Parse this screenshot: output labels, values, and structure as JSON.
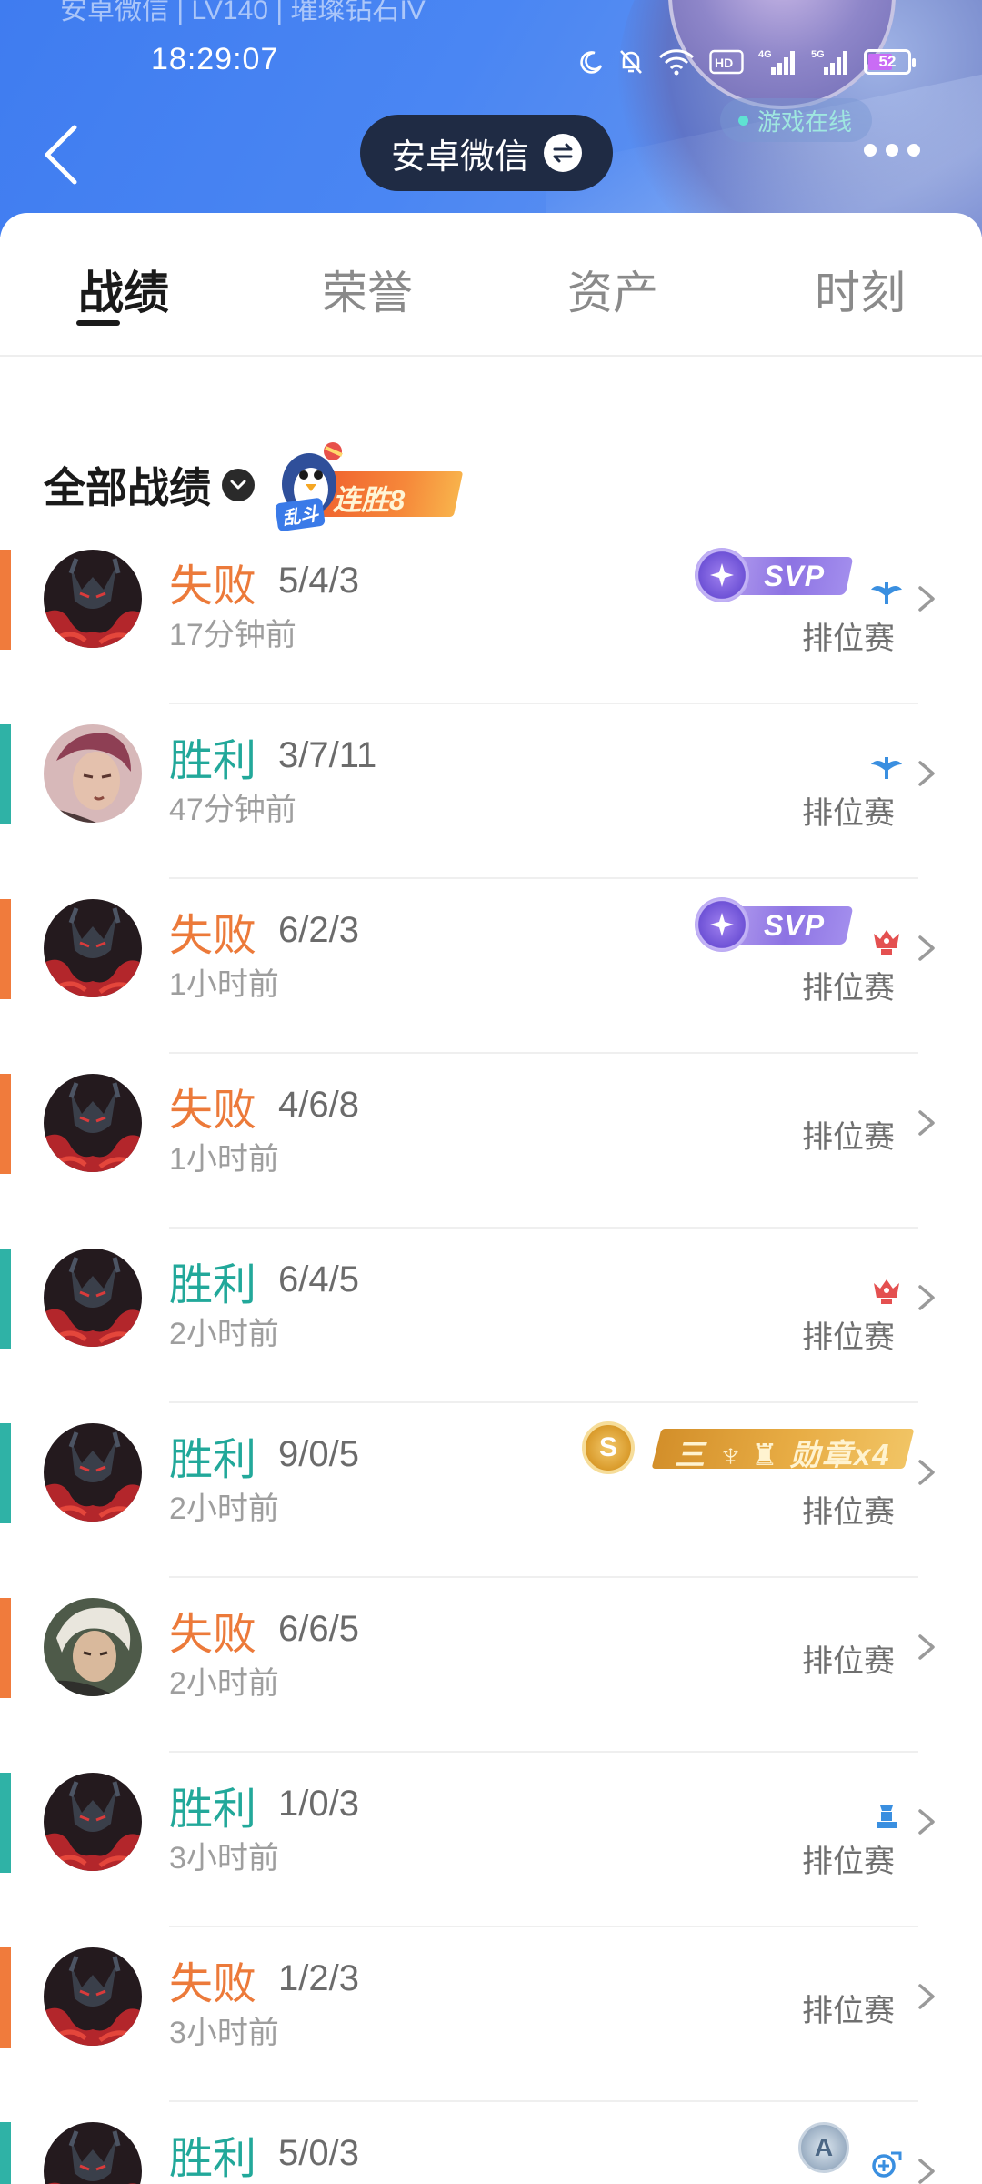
{
  "header": {
    "faded_title": "安卓微信 | LV140 | 璀璨钻石IV",
    "account_name": "安卓微信",
    "online_status": "游戏在线"
  },
  "status_bar": {
    "time": "18:29:07",
    "battery": "52",
    "network_labels": [
      "HD",
      "4G",
      "5G"
    ]
  },
  "tabs": [
    {
      "label": "战绩",
      "active": true
    },
    {
      "label": "荣誉",
      "active": false
    },
    {
      "label": "资产",
      "active": false
    },
    {
      "label": "时刻",
      "active": false
    }
  ],
  "section": {
    "title": "全部战绩",
    "streak_tag": "乱斗",
    "streak_label": "连胜8"
  },
  "matches": [
    {
      "result": "失败",
      "outcome": "loss",
      "kda": "5/4/3",
      "time": "17分钟前",
      "mode": "排位赛",
      "badge": "SVP",
      "mode_icon": "blue-wing-icon"
    },
    {
      "result": "胜利",
      "outcome": "win",
      "kda": "3/7/11",
      "time": "47分钟前",
      "mode": "排位赛",
      "badge": "",
      "mode_icon": "blue-wing-icon"
    },
    {
      "result": "失败",
      "outcome": "loss",
      "kda": "6/2/3",
      "time": "1小时前",
      "mode": "排位赛",
      "badge": "SVP",
      "mode_icon": "red-crest-icon"
    },
    {
      "result": "失败",
      "outcome": "loss",
      "kda": "4/6/8",
      "time": "1小时前",
      "mode": "排位赛",
      "badge": "",
      "mode_icon": ""
    },
    {
      "result": "胜利",
      "outcome": "win",
      "kda": "6/4/5",
      "time": "2小时前",
      "mode": "排位赛",
      "badge": "",
      "mode_icon": "red-crest-icon"
    },
    {
      "result": "胜利",
      "outcome": "win",
      "kda": "9/0/5",
      "time": "2小时前",
      "mode": "排位赛",
      "badge": "MEDAL",
      "medal_text": "三 ♆ ♜ 勋章x4",
      "mode_icon": ""
    },
    {
      "result": "失败",
      "outcome": "loss",
      "kda": "6/6/5",
      "time": "2小时前",
      "mode": "排位赛",
      "badge": "",
      "mode_icon": ""
    },
    {
      "result": "胜利",
      "outcome": "win",
      "kda": "1/0/3",
      "time": "3小时前",
      "mode": "排位赛",
      "badge": "",
      "mode_icon": "blue-tower-icon"
    },
    {
      "result": "失败",
      "outcome": "loss",
      "kda": "1/2/3",
      "time": "3小时前",
      "mode": "排位赛",
      "badge": "",
      "mode_icon": ""
    },
    {
      "result": "胜利",
      "outcome": "win",
      "kda": "5/0/3",
      "time": "",
      "mode": "",
      "badge": "A",
      "mode_icon": "blue-rune-icon"
    }
  ],
  "colors": {
    "win": "#22a89a",
    "loss": "#ec7a3a",
    "header_blue": "#4a86f3",
    "svp_purple": "#8d73e3",
    "medal_gold": "#e8ad45"
  }
}
